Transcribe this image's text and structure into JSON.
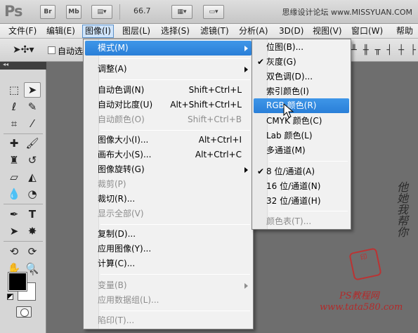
{
  "appbar": {
    "logo": "Ps",
    "bridge_label": "Br",
    "minibridge_label": "Mb",
    "zoom": "66.7",
    "watermark": "思缘设计论坛 www.MISSYUAN.COM"
  },
  "menubar": {
    "items": [
      "文件(F)",
      "编辑(E)",
      "图像(I)",
      "图层(L)",
      "选择(S)",
      "滤镜(T)",
      "分析(A)",
      "3D(D)",
      "视图(V)",
      "窗口(W)",
      "帮助("
    ]
  },
  "optbar": {
    "auto_label": "自动选"
  },
  "image_menu": {
    "items": [
      {
        "label": "模式(M)",
        "shortcut": "",
        "submenu": true,
        "state": "highlighted"
      },
      {
        "label": "调整(A)",
        "shortcut": "",
        "submenu": true,
        "state": "normal"
      },
      {
        "label": "自动色调(N)",
        "shortcut": "Shift+Ctrl+L",
        "submenu": false,
        "state": "normal"
      },
      {
        "label": "自动对比度(U)",
        "shortcut": "Alt+Shift+Ctrl+L",
        "submenu": false,
        "state": "normal"
      },
      {
        "label": "自动颜色(O)",
        "shortcut": "Shift+Ctrl+B",
        "submenu": false,
        "state": "disabled"
      },
      {
        "label": "图像大小(I)...",
        "shortcut": "Alt+Ctrl+I",
        "submenu": false,
        "state": "normal"
      },
      {
        "label": "画布大小(S)...",
        "shortcut": "Alt+Ctrl+C",
        "submenu": false,
        "state": "normal"
      },
      {
        "label": "图像旋转(G)",
        "shortcut": "",
        "submenu": true,
        "state": "normal"
      },
      {
        "label": "裁剪(P)",
        "shortcut": "",
        "submenu": false,
        "state": "disabled"
      },
      {
        "label": "裁切(R)...",
        "shortcut": "",
        "submenu": false,
        "state": "normal"
      },
      {
        "label": "显示全部(V)",
        "shortcut": "",
        "submenu": false,
        "state": "disabled"
      },
      {
        "label": "复制(D)...",
        "shortcut": "",
        "submenu": false,
        "state": "normal"
      },
      {
        "label": "应用图像(Y)...",
        "shortcut": "",
        "submenu": false,
        "state": "normal"
      },
      {
        "label": "计算(C)...",
        "shortcut": "",
        "submenu": false,
        "state": "normal"
      },
      {
        "label": "变量(B)",
        "shortcut": "",
        "submenu": true,
        "state": "disabled"
      },
      {
        "label": "应用数据组(L)...",
        "shortcut": "",
        "submenu": false,
        "state": "disabled"
      },
      {
        "label": "陷印(T)...",
        "shortcut": "",
        "submenu": false,
        "state": "disabled"
      }
    ]
  },
  "mode_submenu": {
    "items": [
      {
        "label": "位图(B)...",
        "checked": false,
        "state": "normal"
      },
      {
        "label": "灰度(G)",
        "checked": true,
        "state": "normal"
      },
      {
        "label": "双色调(D)...",
        "checked": false,
        "state": "normal"
      },
      {
        "label": "索引颜色(I)",
        "checked": false,
        "state": "normal"
      },
      {
        "label": "RGB 颜色(R)",
        "checked": false,
        "state": "highlighted"
      },
      {
        "label": "CMYK 颜色(C)",
        "checked": false,
        "state": "normal"
      },
      {
        "label": "Lab 颜色(L)",
        "checked": false,
        "state": "normal"
      },
      {
        "label": "多通道(M)",
        "checked": false,
        "state": "normal"
      },
      {
        "label": "8 位/通道(A)",
        "checked": true,
        "state": "normal"
      },
      {
        "label": "16 位/通道(N)",
        "checked": false,
        "state": "normal"
      },
      {
        "label": "32 位/通道(H)",
        "checked": false,
        "state": "normal"
      },
      {
        "label": "颜色表(T)...",
        "checked": false,
        "state": "disabled"
      }
    ]
  },
  "decor": {
    "calligraphy": "他她我帮你",
    "seal_text": "印",
    "site_line1": "PS教程网",
    "site_line2": "www.tata580.com"
  },
  "colors": {
    "highlight": "#2a7fd8",
    "workspace": "#6e6e6e",
    "disabled_text": "#8d8d8d"
  }
}
